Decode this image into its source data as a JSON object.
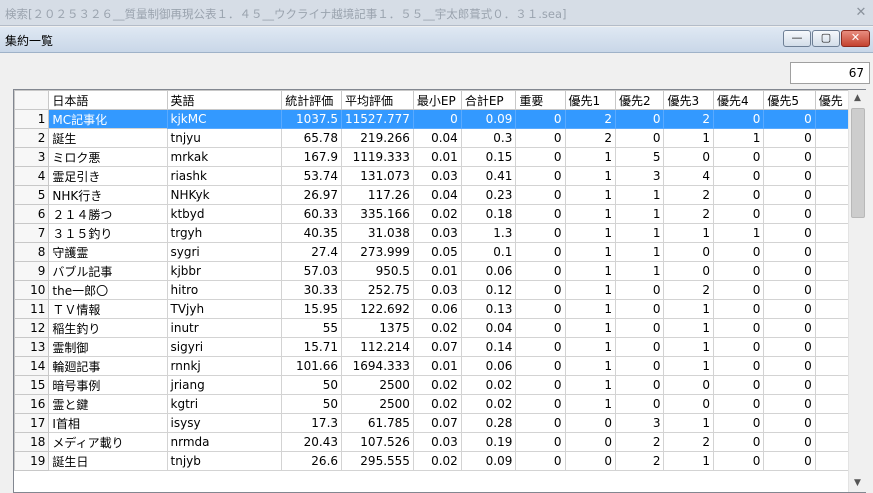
{
  "outer_title": "検索[２０２５３２６__質量制御再現公表１．４５__ウクライナ越境記事１．５５__宇太郎葺式０．３１.sea]",
  "outer_close": "✕",
  "window": {
    "title": "集約一覧",
    "min": "—",
    "max": "▢",
    "close": "✕"
  },
  "count": "67",
  "columns": [
    "日本語",
    "英語",
    "統計評価",
    "平均評価",
    "最小EP",
    "合計EP",
    "重要",
    "優先1",
    "優先2",
    "優先3",
    "優先4",
    "優先5",
    "優先"
  ],
  "rows": [
    [
      "1",
      "MC記事化",
      "kjkMC",
      "1037.5",
      "11527.777",
      "0",
      "0.09",
      "0",
      "2",
      "0",
      "2",
      "0",
      "0",
      ""
    ],
    [
      "2",
      "誕生",
      "tnjyu",
      "65.78",
      "219.266",
      "0.04",
      "0.3",
      "0",
      "2",
      "0",
      "1",
      "1",
      "0",
      ""
    ],
    [
      "3",
      "ミロク悪",
      "mrkak",
      "167.9",
      "1119.333",
      "0.01",
      "0.15",
      "0",
      "1",
      "5",
      "0",
      "0",
      "0",
      ""
    ],
    [
      "4",
      "霊足引き",
      "riashk",
      "53.74",
      "131.073",
      "0.03",
      "0.41",
      "0",
      "1",
      "3",
      "4",
      "0",
      "0",
      ""
    ],
    [
      "5",
      "NHK行き",
      "NHKyk",
      "26.97",
      "117.26",
      "0.04",
      "0.23",
      "0",
      "1",
      "1",
      "2",
      "0",
      "0",
      ""
    ],
    [
      "6",
      "２１４勝つ",
      "ktbyd",
      "60.33",
      "335.166",
      "0.02",
      "0.18",
      "0",
      "1",
      "1",
      "2",
      "0",
      "0",
      ""
    ],
    [
      "7",
      "３１５釣り",
      "trgyh",
      "40.35",
      "31.038",
      "0.03",
      "1.3",
      "0",
      "1",
      "1",
      "1",
      "1",
      "0",
      ""
    ],
    [
      "8",
      "守護霊",
      "sygri",
      "27.4",
      "273.999",
      "0.05",
      "0.1",
      "0",
      "1",
      "1",
      "0",
      "0",
      "0",
      ""
    ],
    [
      "9",
      "バブル記事",
      "kjbbr",
      "57.03",
      "950.5",
      "0.01",
      "0.06",
      "0",
      "1",
      "1",
      "0",
      "0",
      "0",
      ""
    ],
    [
      "10",
      "the一郎〇",
      "hitro",
      "30.33",
      "252.75",
      "0.03",
      "0.12",
      "0",
      "1",
      "0",
      "2",
      "0",
      "0",
      ""
    ],
    [
      "11",
      "ＴＶ情報",
      "TVjyh",
      "15.95",
      "122.692",
      "0.06",
      "0.13",
      "0",
      "1",
      "0",
      "1",
      "0",
      "0",
      ""
    ],
    [
      "12",
      "稲生釣り",
      "inutr",
      "55",
      "1375",
      "0.02",
      "0.04",
      "0",
      "1",
      "0",
      "1",
      "0",
      "0",
      ""
    ],
    [
      "13",
      "霊制御",
      "sigyri",
      "15.71",
      "112.214",
      "0.07",
      "0.14",
      "0",
      "1",
      "0",
      "1",
      "0",
      "0",
      ""
    ],
    [
      "14",
      "輪廻記事",
      "rnnkj",
      "101.66",
      "1694.333",
      "0.01",
      "0.06",
      "0",
      "1",
      "0",
      "1",
      "0",
      "0",
      ""
    ],
    [
      "15",
      "暗号事例",
      "jriang",
      "50",
      "2500",
      "0.02",
      "0.02",
      "0",
      "1",
      "0",
      "0",
      "0",
      "0",
      ""
    ],
    [
      "16",
      "霊と鍵",
      "kgtri",
      "50",
      "2500",
      "0.02",
      "0.02",
      "0",
      "1",
      "0",
      "0",
      "0",
      "0",
      ""
    ],
    [
      "17",
      "I首相",
      "isysy",
      "17.3",
      "61.785",
      "0.07",
      "0.28",
      "0",
      "0",
      "3",
      "1",
      "0",
      "0",
      ""
    ],
    [
      "18",
      "メディア載り",
      "nrmda",
      "20.43",
      "107.526",
      "0.03",
      "0.19",
      "0",
      "0",
      "2",
      "2",
      "0",
      "0",
      ""
    ],
    [
      "19",
      "誕生日",
      "tnjyb",
      "26.6",
      "295.555",
      "0.02",
      "0.09",
      "0",
      "0",
      "2",
      "1",
      "0",
      "0",
      ""
    ]
  ],
  "scroll": {
    "up": "▲",
    "down": "▼"
  }
}
